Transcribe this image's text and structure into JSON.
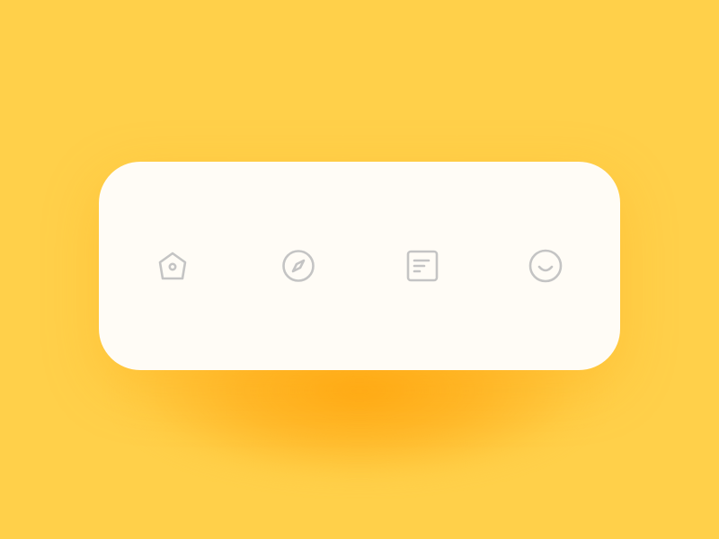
{
  "colors": {
    "background": "#FFD04A",
    "glow": "#FFA812",
    "bar": "#FFFCF6",
    "icon": "#C4C4C4"
  },
  "tab_bar": {
    "tabs": [
      {
        "icon": "home-icon"
      },
      {
        "icon": "compass-icon"
      },
      {
        "icon": "document-icon"
      },
      {
        "icon": "smiley-icon"
      }
    ]
  }
}
